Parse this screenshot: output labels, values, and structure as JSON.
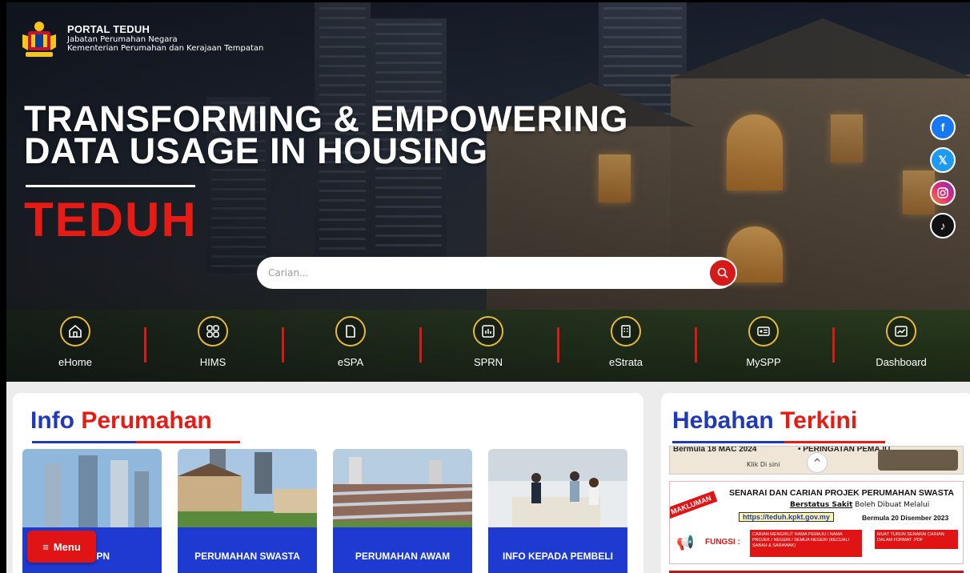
{
  "brand": {
    "title": "PORTAL TEDUH",
    "line1": "Jabatan Perumahan Negara",
    "line2": "Kementerian Perumahan dan Kerajaan Tempatan"
  },
  "hero": {
    "headline_line1": "TRANSFORMING & EMPOWERING",
    "headline_line2": "DATA USAGE IN HOUSING",
    "brand_word": "TEDUH"
  },
  "search": {
    "placeholder": "Carian..."
  },
  "social": [
    "facebook-icon",
    "x-icon",
    "instagram-icon",
    "tiktok-icon"
  ],
  "nav": {
    "items": [
      {
        "label": "eHome",
        "icon": "home-icon"
      },
      {
        "label": "HIMS",
        "icon": "grid-icon"
      },
      {
        "label": "eSPA",
        "icon": "document-icon"
      },
      {
        "label": "SPRN",
        "icon": "bar-chart-icon"
      },
      {
        "label": "eStrata",
        "icon": "building-icon"
      },
      {
        "label": "MySPP",
        "icon": "id-card-icon"
      },
      {
        "label": "Dashboard",
        "icon": "trend-chart-icon"
      }
    ]
  },
  "info": {
    "title_a": "Info",
    "title_b": "Perumahan",
    "cards": [
      {
        "label": "UK JPN"
      },
      {
        "label": "PERUMAHAN SWASTA"
      },
      {
        "label": "PERUMAHAN AWAM"
      },
      {
        "label": "INFO KEPADA PEMBELI"
      }
    ]
  },
  "menu": {
    "label": "Menu"
  },
  "hebahan": {
    "title_a": "Hebahan",
    "title_b": "Terkini",
    "banner1": {
      "text_a": "Bermula 18 MAC 2024",
      "text_b": "• PERINGATAN PEMAJU",
      "text_c": "Klik Di sini"
    },
    "banner2": {
      "tag": "MAKLUMAN",
      "heading": "SENARAI DAN CARIAN PROJEK PERUMAHAN SWASTA",
      "sub_a": "Berstatus Sakit",
      "sub_b": "Boleh Dibuat Melalui",
      "url": "https://teduh.kpkt.gov.my",
      "date": "Bermula 20 Disember 2023",
      "fungsi": "FUNGSI :",
      "f1": "CARIAN MENGIKUT NAMA PEMAJU / NAMA PROJEK / NEGERI / SEMUA NEGERI (KECUALI SABAH & SARAWAK)",
      "f2": "MUAT TURUN SENARAI CARIAN DALAM FORMAT .PDF"
    }
  },
  "colors": {
    "brand_red": "#e51b14",
    "brand_blue": "#1f3ab8",
    "card_blue": "#1f3ad0"
  }
}
